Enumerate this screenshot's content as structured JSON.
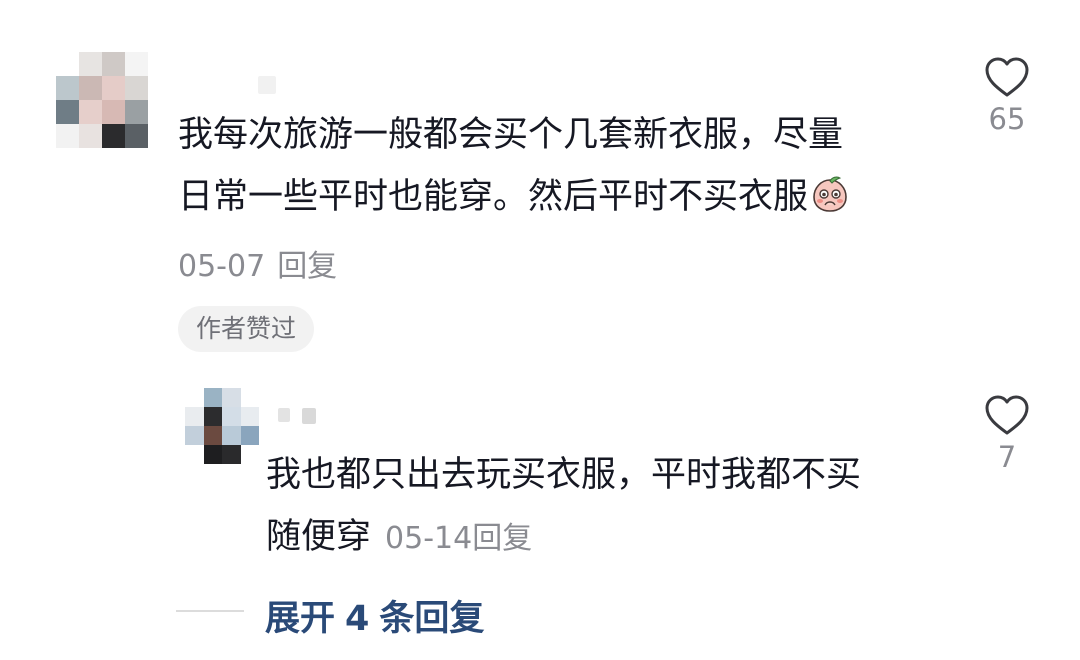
{
  "comment": {
    "lines": [
      "我每次旅游一般都会买个几套新衣服，尽量",
      "日常一些平时也能穿。然后平时不买衣服"
    ],
    "emoji": "peach-blush-emoji",
    "date": "05-07",
    "reply_label": "回复",
    "badge": "作者赞过",
    "likes": "65"
  },
  "reply": {
    "lines": [
      "我也都只出去玩买衣服，平时我都不买",
      "随便穿"
    ],
    "date": "05-14",
    "reply_label": "回复",
    "likes": "7"
  },
  "expand": {
    "label_prefix": "展开",
    "count": "4",
    "label_suffix": "条回复"
  },
  "icons": {
    "like": "heart-outline-icon"
  },
  "colors": {
    "text": "#161823",
    "meta": "#8a8b91",
    "link": "#2a4a78",
    "badge_bg": "#f2f2f2"
  }
}
